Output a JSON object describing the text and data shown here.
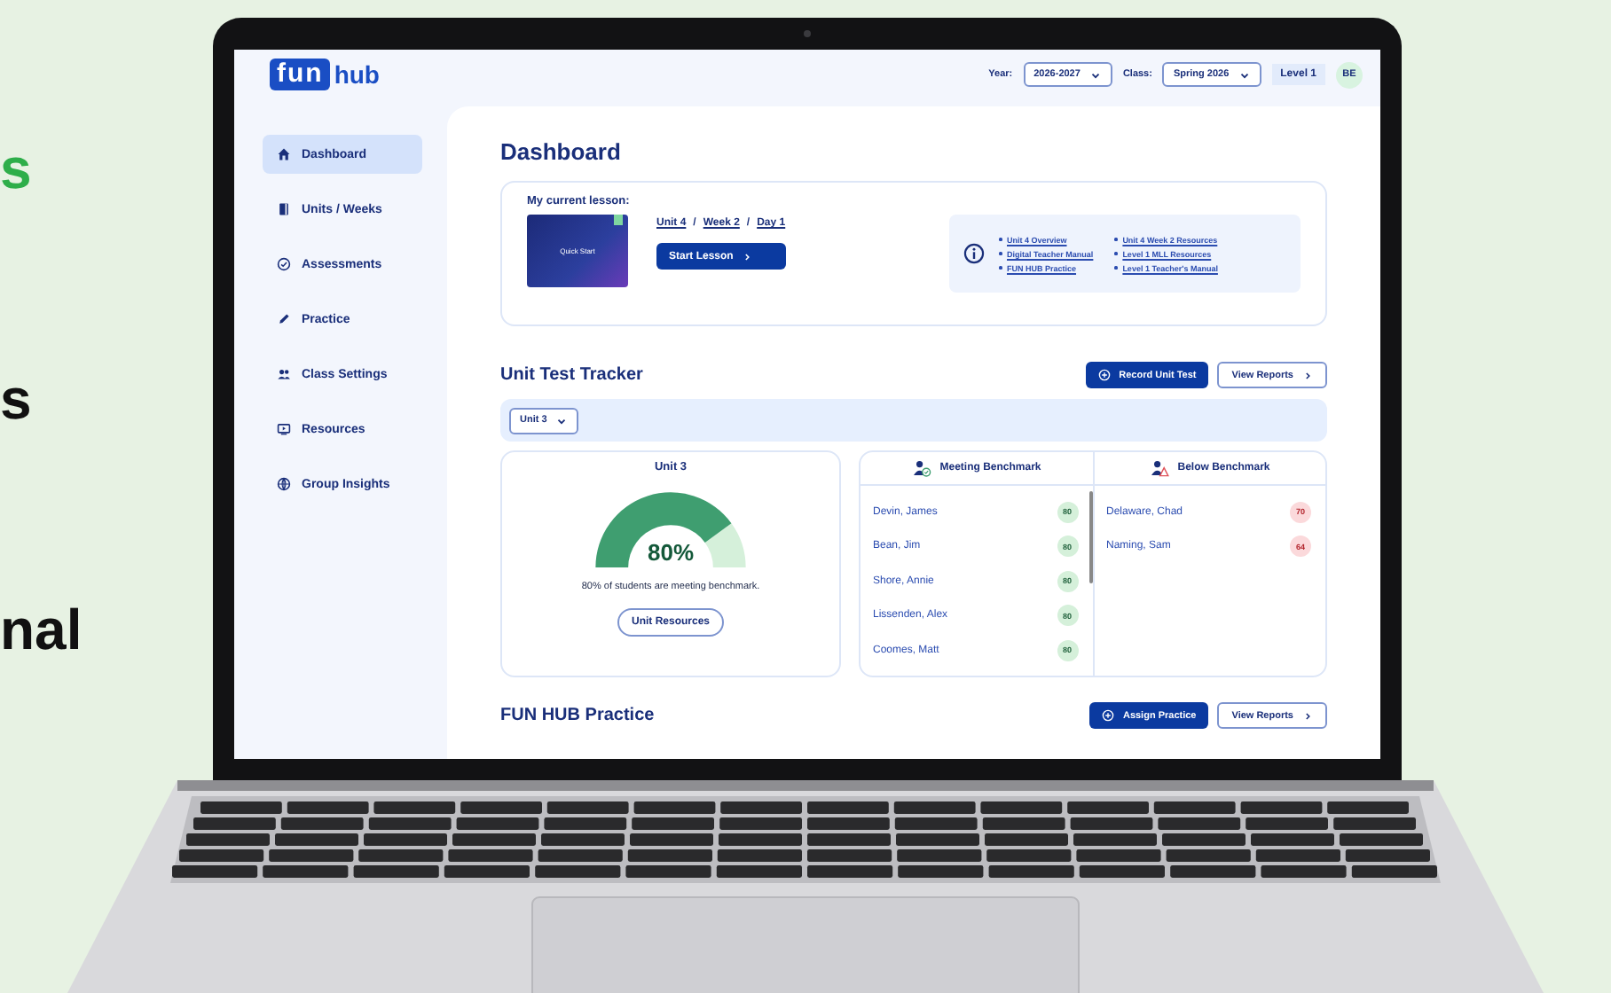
{
  "side_text": [
    {
      "kind": "accent",
      "text": "s"
    },
    {
      "kind": "plain",
      "text": "s"
    },
    {
      "kind": "plain",
      "text": "nal"
    }
  ],
  "logo": {
    "tiles": "fun",
    "word": "hub"
  },
  "header": {
    "year_label": "Year:",
    "year": "2026-2027",
    "class_label": "Class:",
    "class": "Spring 2026",
    "level": "Level 1",
    "avatar": "BE"
  },
  "sidebar": {
    "items": [
      {
        "kind": "home",
        "label": "Dashboard",
        "selected": true
      },
      {
        "kind": "book",
        "label": "Units / Weeks",
        "selected": false
      },
      {
        "kind": "check",
        "label": "Assessments",
        "selected": false
      },
      {
        "kind": "pencil",
        "label": "Practice",
        "selected": false
      },
      {
        "kind": "people",
        "label": "Class Settings",
        "selected": false
      },
      {
        "kind": "play",
        "label": "Resources",
        "selected": false
      },
      {
        "kind": "globe",
        "label": "Group Insights",
        "selected": false
      }
    ]
  },
  "page_title": "Dashboard",
  "lesson": {
    "heading": "My current lesson:",
    "thumbnail_text": "Quick Start",
    "breadcrumb": [
      {
        "kind": "link",
        "text": "Unit 4"
      },
      {
        "kind": "separator",
        "text": "/"
      },
      {
        "kind": "link",
        "text": "Week 2"
      },
      {
        "kind": "separator",
        "text": "/"
      },
      {
        "kind": "link",
        "text": "Day 1"
      }
    ],
    "button": "Start Lesson",
    "links": [
      "Unit 4 Overview",
      "Digital Teacher Manual",
      "FUN HUB Practice",
      "Unit 4 Week 2 Resources",
      "Level 1 MLL Resources",
      "Level 1 Teacher's Manual"
    ]
  },
  "tracker": {
    "title": "Unit Test Tracker",
    "record_button": "Record Unit Test",
    "reports_button": "View Reports",
    "filter": "Unit 3",
    "gauge": {
      "title": "Unit 3",
      "level": 0.8,
      "reading": "80%",
      "caption": "80% of students are meeting benchmark.",
      "button": "Unit Resources"
    },
    "groups": [
      {
        "kind": "meeting",
        "title": "Meeting Benchmark",
        "students": [
          {
            "name": "Devin, James",
            "score": "80"
          },
          {
            "name": "Bean, Jim",
            "score": "80"
          },
          {
            "name": "Shore, Annie",
            "score": "80"
          },
          {
            "name": "Lissenden, Alex",
            "score": "80"
          },
          {
            "name": "Coomes, Matt",
            "score": "80"
          }
        ]
      },
      {
        "kind": "below",
        "title": "Below Benchmark",
        "students": [
          {
            "name": "Delaware, Chad",
            "score": "70"
          },
          {
            "name": "Naming, Sam",
            "score": "64"
          }
        ]
      }
    ]
  },
  "practice": {
    "title": "FUN HUB Practice",
    "assign_button": "Assign Practice",
    "reports_button": "View Reports"
  }
}
